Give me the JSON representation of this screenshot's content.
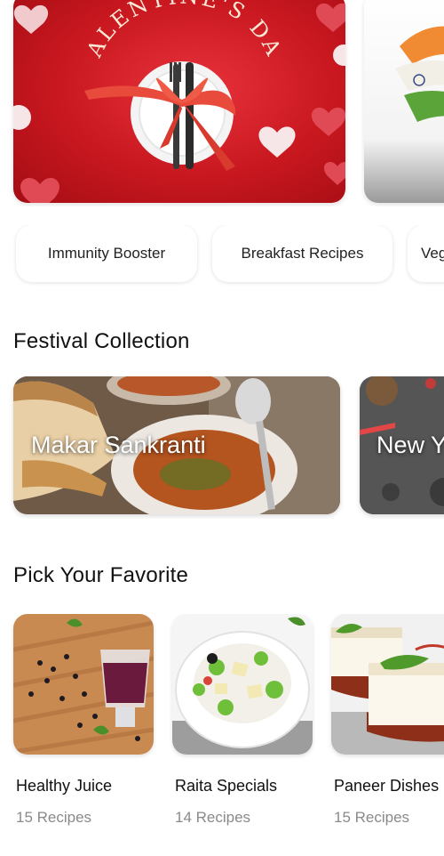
{
  "hero": {
    "banners": [
      {
        "title_art": "VALENTINE'S DAY"
      }
    ]
  },
  "categories": [
    {
      "label": "Immunity Booster"
    },
    {
      "label": "Breakfast Recipes"
    },
    {
      "label": "Veg"
    }
  ],
  "festival": {
    "title": "Festival Collection",
    "items": [
      {
        "label": "Makar Sankranti"
      },
      {
        "label": "New Y"
      }
    ]
  },
  "favorites": {
    "title": "Pick Your Favorite",
    "items": [
      {
        "name": "Healthy Juice",
        "count": "15 Recipes"
      },
      {
        "name": "Raita Specials",
        "count": "14 Recipes"
      },
      {
        "name": "Paneer Dishes",
        "count": "15 Recipes"
      }
    ]
  }
}
